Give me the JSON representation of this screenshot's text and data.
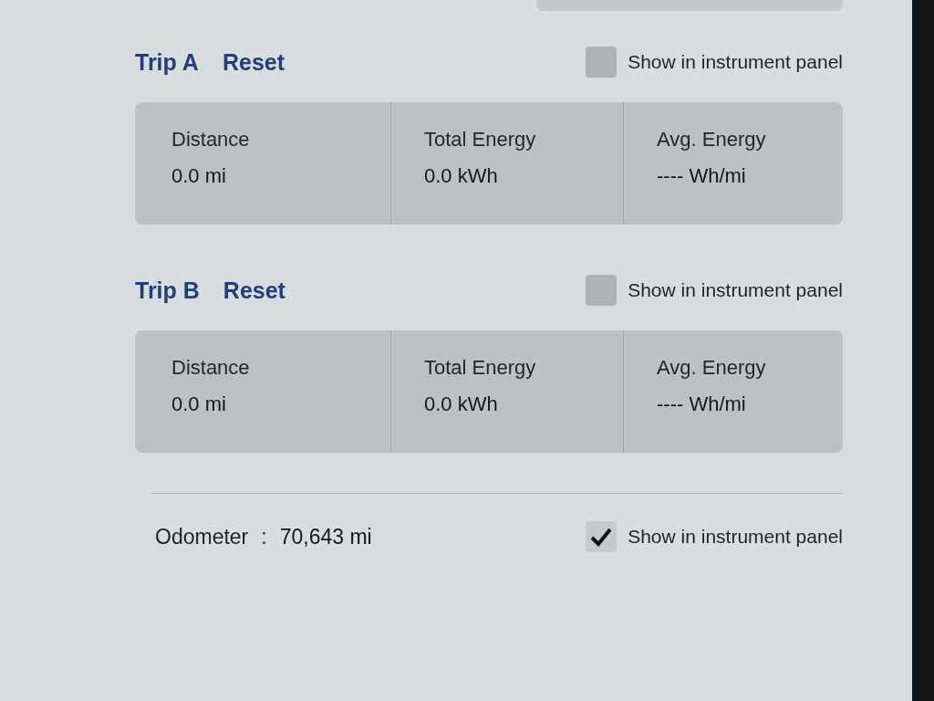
{
  "trips": [
    {
      "title": "Trip A",
      "reset": "Reset",
      "show_in_panel": {
        "label": "Show in instrument panel",
        "checked": false
      },
      "stats": [
        {
          "label": "Distance",
          "value": "0.0 mi"
        },
        {
          "label": "Total Energy",
          "value": "0.0 kWh"
        },
        {
          "label": "Avg. Energy",
          "value": "---- Wh/mi"
        }
      ]
    },
    {
      "title": "Trip B",
      "reset": "Reset",
      "show_in_panel": {
        "label": "Show in instrument panel",
        "checked": false
      },
      "stats": [
        {
          "label": "Distance",
          "value": "0.0 mi"
        },
        {
          "label": "Total Energy",
          "value": "0.0 kWh"
        },
        {
          "label": "Avg. Energy",
          "value": "---- Wh/mi"
        }
      ]
    }
  ],
  "odometer": {
    "label": "Odometer",
    "separator": ":",
    "value": "70,643 mi",
    "show_in_panel": {
      "label": "Show in instrument panel",
      "checked": true
    }
  }
}
